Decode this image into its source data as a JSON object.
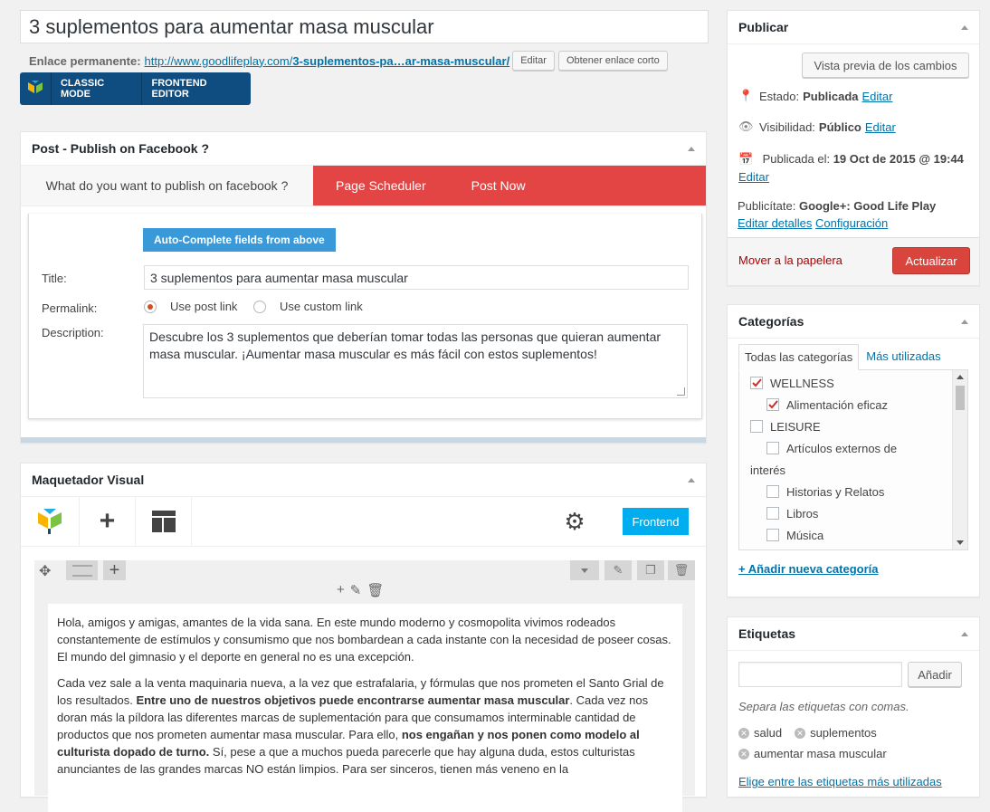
{
  "post": {
    "title": "3 suplementos para aumentar masa muscular",
    "permalink_label": "Enlace permanente:",
    "permalink_base": "http://www.goodlifeplay.com/",
    "permalink_slug": "3-suplementos-pa…ar-masa-muscular/",
    "edit_button": "Editar",
    "shortlink_button": "Obtener enlace corto"
  },
  "vc_switch": {
    "classic": "CLASSIC MODE",
    "frontend": "FRONTEND EDITOR"
  },
  "fb_box": {
    "title": "Post - Publish on Facebook ?",
    "tab_question": "What do you want to publish on facebook ?",
    "tab_scheduler": "Page Scheduler",
    "tab_postnow": "Post Now",
    "autocomplete_button": "Auto-Complete fields from above",
    "title_label": "Title:",
    "title_value": "3 suplementos para aumentar masa muscular",
    "permalink_label": "Permalink:",
    "radio_post_link": "Use post link",
    "radio_custom_link": "Use custom link",
    "description_label": "Description:",
    "description_value": "Descubre los 3 suplementos que deberían tomar todas las personas que quieran aumentar masa muscular. ¡Aumentar masa muscular es más fácil con estos suplementos!"
  },
  "vc": {
    "title": "Maquetador Visual",
    "frontend_button": "Frontend",
    "paragraphs": [
      "Hola, amigos y amigas, amantes de la vida sana. En este mundo moderno y cosmopolita vivimos rodeados constantemente de estímulos y consumismo que nos bombardean a cada instante con la necesidad de poseer cosas. El mundo del gimnasio y el deporte en general no es una excepción."
    ],
    "p2_a": "Cada vez sale a la venta maquinaria nueva, a la vez que estrafalaria, y fórmulas que nos prometen el Santo Grial de los resultados. ",
    "p2_b": "Entre uno de nuestros objetivos puede encontrarse aumentar masa muscular",
    "p2_c": ". Cada vez nos doran más la píldora las diferentes marcas de suplementación para que consumamos interminable cantidad de productos que nos prometen aumentar masa muscular. Para ello, ",
    "p2_d": "nos engañan y nos ponen como modelo al culturista dopado de turno.",
    "p2_e": " Sí, pese a que a muchos pueda parecerle que hay alguna duda, estos culturistas anunciantes de las grandes marcas NO están limpios. Para ser sinceros, tienen más veneno en la"
  },
  "publish": {
    "title": "Publicar",
    "preview_button": "Vista previa de los cambios",
    "status_label": "Estado:",
    "status_value": "Publicada",
    "visibility_label": "Visibilidad:",
    "visibility_value": "Público",
    "published_label": "Publicada el:",
    "published_value": "19 Oct de 2015 @ 19:44",
    "edit_link": "Editar",
    "share_label": "Publicítate:",
    "share_value": "Google+: Good Life Play",
    "edit_details": "Editar detalles",
    "config_link": "Configuración",
    "trash_link": "Mover a la papelera",
    "update_button": "Actualizar"
  },
  "categories": {
    "title": "Categorías",
    "tab_all": "Todas las categorías",
    "tab_most_used": "Más utilizadas",
    "items": [
      {
        "label": "WELLNESS",
        "checked": true,
        "indent": 0
      },
      {
        "label": "Alimentación eficaz",
        "checked": true,
        "indent": 1
      },
      {
        "label": "LEISURE",
        "checked": false,
        "indent": 0
      },
      {
        "label": "Artículos externos de",
        "checked": false,
        "indent": 1
      },
      {
        "label": "interés",
        "checked": false,
        "indent": -1
      },
      {
        "label": "Historias y Relatos",
        "checked": false,
        "indent": 1
      },
      {
        "label": "Libros",
        "checked": false,
        "indent": 1
      },
      {
        "label": "Música",
        "checked": false,
        "indent": 1
      }
    ],
    "add_new": "+ Añadir nueva categoría"
  },
  "tags": {
    "title": "Etiquetas",
    "add_button": "Añadir",
    "hint": "Separa las etiquetas con comas.",
    "items": [
      "salud",
      "suplementos",
      "aumentar masa muscular"
    ],
    "choose_most_used": "Elige entre las etiquetas más utilizadas"
  }
}
